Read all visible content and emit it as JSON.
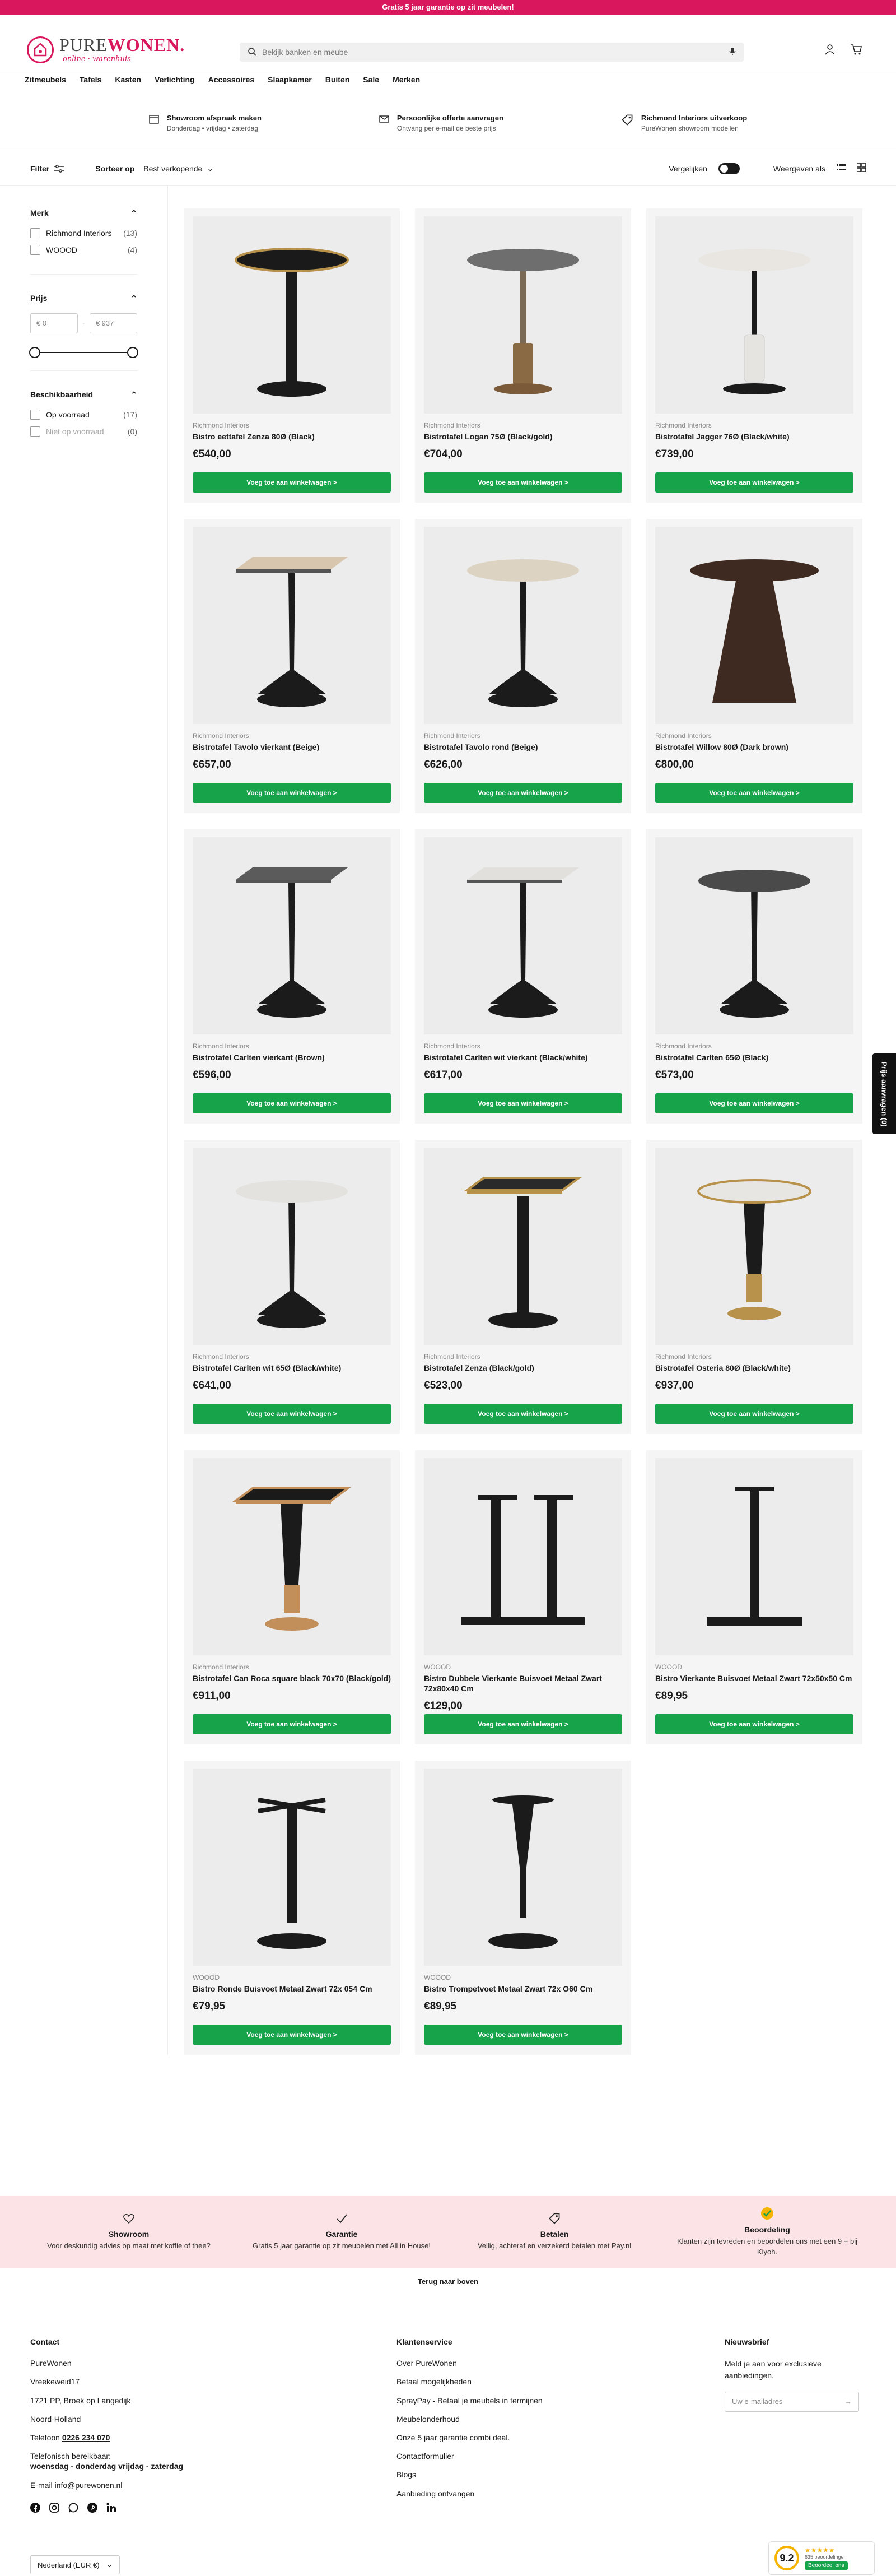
{
  "announcement": "Gratis 5 jaar garantie op zit meubelen!",
  "brand": {
    "name_main": "PURE",
    "name_accent": "WONEN.",
    "tagline": "online · warenhuis"
  },
  "search": {
    "placeholder": "Bekijk banken en meube"
  },
  "nav": [
    "Zitmeubels",
    "Tafels",
    "Kasten",
    "Verlichting",
    "Accessoires",
    "Slaapkamer",
    "Buiten",
    "Sale",
    "Merken"
  ],
  "usps": [
    {
      "title": "Showroom afspraak maken",
      "sub": "Donderdag • vrijdag • zaterdag",
      "icon": "calendar-icon"
    },
    {
      "title": "Persoonlijke offerte aanvragen",
      "sub": "Ontvang per e-mail de beste prijs",
      "icon": "mail-icon"
    },
    {
      "title": "Richmond Interiors uitverkoop",
      "sub": "PureWonen showroom modellen",
      "icon": "tag-icon"
    }
  ],
  "toolbar": {
    "filter": "Filter",
    "sort_label": "Sorteer op",
    "sort_value": "Best verkopende",
    "compare": "Vergelijken",
    "view_label": "Weergeven als"
  },
  "filters": {
    "brand_title": "Merk",
    "brands": [
      {
        "label": "Richmond Interiors",
        "count": "(13)"
      },
      {
        "label": "WOOOD",
        "count": "(4)"
      }
    ],
    "price_title": "Prijs",
    "price_min": "€  0",
    "price_max": "€  937",
    "availability_title": "Beschikbaarheid",
    "availability": [
      {
        "label": "Op voorraad",
        "count": "(17)"
      },
      {
        "label": "Niet op voorraad",
        "count": "(0)"
      }
    ]
  },
  "add_to_cart": "Voeg toe aan winkelwagen >",
  "products": [
    {
      "brand": "Richmond Interiors",
      "name": "Bistro eettafel Zenza 80Ø (Black)",
      "price": "€540,00",
      "shape": "round",
      "top": "#1a1a1a",
      "base": "pedestal",
      "edge": "#b8924a"
    },
    {
      "brand": "Richmond Interiors",
      "name": "Bistrotafel Logan 75Ø (Black/gold)",
      "price": "€704,00",
      "shape": "round",
      "top": "#6e6e6e",
      "base": "column-gold",
      "edge": ""
    },
    {
      "brand": "Richmond Interiors",
      "name": "Bistrotafel Jagger 76Ø (Black/white)",
      "price": "€739,00",
      "shape": "round",
      "top": "#e9e6e1",
      "base": "marble-column",
      "edge": ""
    },
    {
      "brand": "Richmond Interiors",
      "name": "Bistrotafel Tavolo vierkant (Beige)",
      "price": "€657,00",
      "shape": "square",
      "top": "#d8c7ae",
      "base": "tulip",
      "edge": ""
    },
    {
      "brand": "Richmond Interiors",
      "name": "Bistrotafel Tavolo rond (Beige)",
      "price": "€626,00",
      "shape": "round",
      "top": "#ddd3c3",
      "base": "tulip",
      "edge": ""
    },
    {
      "brand": "Richmond Interiors",
      "name": "Bistrotafel Willow 80Ø (Dark brown)",
      "price": "€800,00",
      "shape": "round",
      "top": "#3e2a20",
      "base": "cone",
      "edge": ""
    },
    {
      "brand": "Richmond Interiors",
      "name": "Bistrotafel Carlten vierkant (Brown)",
      "price": "€596,00",
      "shape": "square",
      "top": "#5b5b5b",
      "base": "tulip",
      "edge": ""
    },
    {
      "brand": "Richmond Interiors",
      "name": "Bistrotafel Carlten wit vierkant (Black/white)",
      "price": "€617,00",
      "shape": "square",
      "top": "#e2e0dc",
      "base": "tulip",
      "edge": ""
    },
    {
      "brand": "Richmond Interiors",
      "name": "Bistrotafel Carlten 65Ø (Black)",
      "price": "€573,00",
      "shape": "round",
      "top": "#4a4a4a",
      "base": "tulip",
      "edge": ""
    },
    {
      "brand": "Richmond Interiors",
      "name": "Bistrotafel Carlten wit 65Ø (Black/white)",
      "price": "€641,00",
      "shape": "round",
      "top": "#e4e2de",
      "base": "tulip",
      "edge": ""
    },
    {
      "brand": "Richmond Interiors",
      "name": "Bistrotafel Zenza (Black/gold)",
      "price": "€523,00",
      "shape": "square",
      "top": "#2a2a2a",
      "base": "pedestal",
      "edge": "#b8924a"
    },
    {
      "brand": "Richmond Interiors",
      "name": "Bistrotafel Osteria 80Ø (Black/white)",
      "price": "€937,00",
      "shape": "round",
      "top": "#e8e6e2",
      "base": "gold-foot",
      "edge": "#b8924a"
    },
    {
      "brand": "Richmond Interiors",
      "name": "Bistrotafel Can Roca square black 70x70 (Black/gold)",
      "price": "€911,00",
      "shape": "square",
      "top": "#1a1a1a",
      "base": "gold-foot",
      "edge": "#c28e5a"
    },
    {
      "brand": "WOOOD",
      "name": "Bistro Dubbele Vierkante Buisvoet Metaal Zwart 72x80x40 Cm",
      "price": "€129,00",
      "shape": "double",
      "top": "",
      "base": "double-frame",
      "edge": ""
    },
    {
      "brand": "WOOOD",
      "name": "Bistro Vierkante Buisvoet Metaal Zwart 72x50x50 Cm",
      "price": "€89,95",
      "shape": "frame",
      "top": "",
      "base": "square-frame",
      "edge": ""
    },
    {
      "brand": "WOOOD",
      "name": "Bistro Ronde Buisvoet Metaal Zwart 72x 054 Cm",
      "price": "€79,95",
      "shape": "frame",
      "top": "",
      "base": "cross-frame",
      "edge": ""
    },
    {
      "brand": "WOOOD",
      "name": "Bistro Trompetvoet Metaal Zwart 72x O60 Cm",
      "price": "€89,95",
      "shape": "frame",
      "top": "",
      "base": "trumpet-frame",
      "edge": ""
    }
  ],
  "compare_tab": "Prijs aanvragen (0)",
  "services": [
    {
      "title": "Showroom",
      "text": "Voor deskundig advies op maat met koffie of thee?",
      "icon": "heart-icon"
    },
    {
      "title": "Garantie",
      "text": "Gratis 5 jaar garantie op zit meubelen met All in House!",
      "icon": "check-icon"
    },
    {
      "title": "Betalen",
      "text": "Veilig, achteraf en verzekerd betalen met Pay.nl",
      "icon": "tag-icon"
    },
    {
      "title": "Beoordeling",
      "text": "Klanten zijn tevreden en beoordelen ons met een 9 + bij Kiyoh.",
      "icon": "badge-icon"
    }
  ],
  "back_to_top": "Terug naar boven",
  "footer": {
    "contact_title": "Contact",
    "contact_lines": [
      "PureWonen",
      "Vreekeweid17",
      "1721 PP, Broek op Langedijk",
      "Noord-Holland"
    ],
    "phone_label": "Telefoon",
    "phone": "0226 234 070",
    "hours_label": "Telefonisch bereikbaar:",
    "hours": "woensdag - donderdag vrijdag - zaterdag",
    "email_label": "E-mail",
    "email": "info@purewonen.nl",
    "service_title": "Klantenservice",
    "service_links": [
      "Over PureWonen",
      "Betaal mogelijkheden",
      "SprayPay - Betaal je meubels in termijnen",
      "Meubelonderhoud",
      "Onze 5 jaar garantie combi deal.",
      "Contactformulier",
      "Blogs",
      "Aanbieding ontvangen"
    ],
    "newsletter_title": "Nieuwsbrief",
    "newsletter_text": "Meld je aan voor exclusieve aanbiedingen.",
    "newsletter_placeholder": "Uw e-mailadres",
    "locale": "Nederland (EUR €)"
  },
  "kiyoh": {
    "score": "9.2",
    "stars": "★★★★★",
    "reviews": "635 beoordelingen",
    "cta": "Beoordeel ons"
  }
}
